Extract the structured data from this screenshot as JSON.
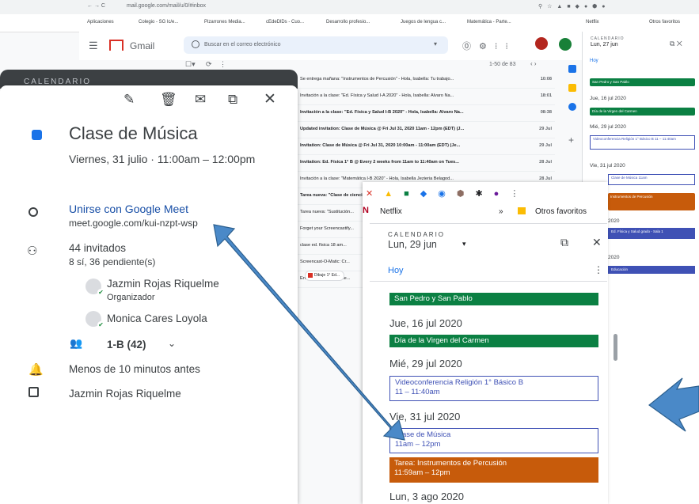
{
  "browser": {
    "address": "mail.google.com/mail/u/0/#inbox",
    "bookmarks": [
      "Aplicaciones",
      "Colegio - SG lc/e...",
      "Pizarrones Media...",
      "cEdeDlDs - Cuo...",
      "Desarrollo profesio...",
      "Juegos de lengua c...",
      "Matemática - Parte...",
      "Netflix",
      "Otros favoritos"
    ]
  },
  "gmail": {
    "logo_text": "Gmail",
    "search_placeholder": "Buscar en el correo electrónico",
    "pagination": "1-50 de 83"
  },
  "emails": [
    {
      "subject": "Se entrega mañana: \"Instrumentos de Percusión\" - Hola, Isabella: Tu trabajo...",
      "date": "10:08",
      "bold": false
    },
    {
      "subject": "Invitación a la clase: \"Ed. Física y Salud I-A 2020\" - Hola, Isabella: Alvaro Na...",
      "date": "18:01",
      "bold": false
    },
    {
      "subject": "Invitación a la clase: \"Ed. Física y Salud I-B 2020\" - Hola, Isabella: Alvaro Na...",
      "date": "08:38",
      "bold": true
    },
    {
      "subject": "Updated invitation: Clase de Música @ Fri Jul 31, 2020 11am - 12pm (EDT) (J...",
      "date": "29 Jul",
      "bold": true
    },
    {
      "subject": "Invitation: Clase de Música @ Fri Jul 31, 2020 10:00am - 11:00am (EDT) (Je...",
      "date": "29 Jul",
      "bold": true
    },
    {
      "subject": "Invitation: Ed. Física 1° B @ Every 2 weeks from 11am to 11:40am on Tues...",
      "date": "28 Jul",
      "bold": true
    },
    {
      "subject": "Invitación a la clase: \"Matemática I-B 2020\" - Hola, Isabella Jezieria Belagod...",
      "date": "28 Jul",
      "bold": false
    },
    {
      "subject": "Tarea nueva: \"Clase de ciencias...",
      "date": "",
      "bold": true
    },
    {
      "subject": "Tarea nueva: \"Sustitución...",
      "date": "",
      "bold": false
    },
    {
      "subject": "Forget your Screencastify...",
      "date": "",
      "bold": false
    },
    {
      "subject": "clase ed. física 18 am...",
      "date": "",
      "bold": false
    },
    {
      "subject": "Screencast-O-Matic: Cr...",
      "date": "",
      "bold": false
    },
    {
      "subject": "Envío códigos de Clase...",
      "date": "",
      "bold": false
    }
  ],
  "attachment": "Dibuje 1° Ed...",
  "side_calendar": {
    "label": "CALENDARIO",
    "date": "Lun, 27 jun",
    "hoy": "Hoy",
    "events": [
      {
        "text": "San Pedro y San Pablo",
        "color": "#0b8043"
      },
      {
        "text": "Día de la Virgen del Carmen",
        "color": "#0b8043"
      },
      {
        "text": "Instrumentos de Percusión",
        "color": "#e65100"
      }
    ],
    "days": [
      "Jue, 16 jul 2020",
      "Mié, 29 jul 2020",
      "Vie, 31 jul 2020",
      "2020",
      "2020"
    ],
    "boxes": [
      "Videoconferencia Religión 1° Básico B 11 – 11:40am",
      "Clase de Música 11am",
      "Educación",
      "Ed. Física y Salud grado - Sala 1"
    ]
  },
  "event": {
    "section_label": "CALENDARIO",
    "title": "Clase de Música",
    "when": "Viernes, 31 julio  ·  11:00am – 12:00pm",
    "meet_link": "Unirse con Google Meet",
    "meet_url": "meet.google.com/kui-nzpt-wsp",
    "guests": "44 invitados",
    "guests_status": "8 sí, 36 pendiente(s)",
    "organizer": "Jazmin Rojas Riquelme",
    "organizer_role": "Organizador",
    "guest2": "Monica Cares Loyola",
    "group": "1-B (42)",
    "notification": "Menos de 10 minutos antes",
    "owner": "Jazmin Rojas Riquelme"
  },
  "zoom_calendar": {
    "bookmarks_left": "Netflix",
    "bookmarks_right": "Otros favoritos",
    "label": "CALENDARIO",
    "date": "Lun, 29 jun",
    "hoy": "Hoy",
    "ev1": "San Pedro y San Pablo",
    "day1": "Jue, 16 jul 2020",
    "ev2": "Día de la Virgen del Carmen",
    "day2": "Mié, 29 jul 2020",
    "ev3_title": "Videoconferencia Religión 1° Básico B",
    "ev3_time": "11 – 11:40am",
    "day3": "Vie, 31 jul 2020",
    "ev4_title": "Clase de Música",
    "ev4_time": "11am – 12pm",
    "ev5_title": "Tarea: Instrumentos de Percusión",
    "ev5_time": "11:59am – 12pm",
    "day4": "Lun, 3 ago 2020"
  },
  "colors": {
    "accent": "#1a73e8",
    "holiday_green": "#0b8043",
    "task_orange": "#c75b0b",
    "event_blue": "#3f51b5",
    "arrow_blue": "#4a89c8"
  }
}
